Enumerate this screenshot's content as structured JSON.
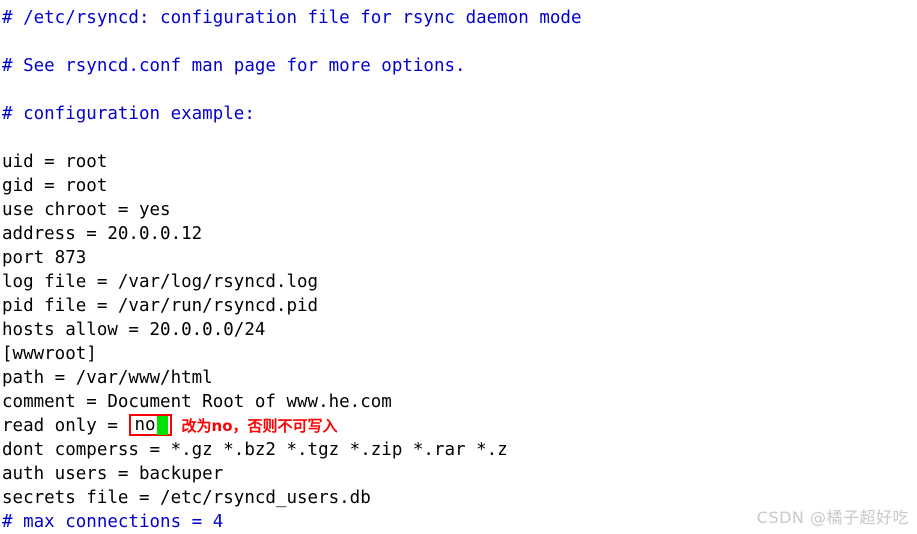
{
  "editor": {
    "lines": [
      {
        "text": "# /etc/rsyncd: configuration file for rsync daemon mode",
        "style": "comment"
      },
      {
        "text": "",
        "style": "normal"
      },
      {
        "text": "# See rsyncd.conf man page for more options.",
        "style": "comment"
      },
      {
        "text": "",
        "style": "normal"
      },
      {
        "text": "# configuration example:",
        "style": "comment"
      },
      {
        "text": "",
        "style": "normal"
      },
      {
        "text": "uid = root",
        "style": "normal"
      },
      {
        "text": "gid = root",
        "style": "normal"
      },
      {
        "text": "use chroot = yes",
        "style": "normal"
      },
      {
        "text": "address = 20.0.0.12",
        "style": "normal"
      },
      {
        "text": "port 873",
        "style": "normal"
      },
      {
        "text": "log file = /var/log/rsyncd.log",
        "style": "normal"
      },
      {
        "text": "pid file = /var/run/rsyncd.pid",
        "style": "normal"
      },
      {
        "text": "hosts allow = 20.0.0.0/24",
        "style": "normal"
      },
      {
        "text": "[wwwroot]",
        "style": "normal"
      },
      {
        "text": "path = /var/www/html",
        "style": "normal"
      },
      {
        "text": "comment = Document Root of www.he.com",
        "style": "normal"
      }
    ],
    "highlighted_line": {
      "prefix": "read only = ",
      "value": "no",
      "annotation": "改为no，否则不可写入",
      "box_color": "#ff0000",
      "cursor_color": "#00e000"
    },
    "lines_after": [
      {
        "text": "dont comperss = *.gz *.bz2 *.tgz *.zip *.rar *.z",
        "style": "normal"
      },
      {
        "text": "auth users = backuper",
        "style": "normal"
      },
      {
        "text": "secrets file = /etc/rsyncd_users.db",
        "style": "normal"
      },
      {
        "text": "# max connections = 4",
        "style": "comment"
      }
    ]
  },
  "watermark": {
    "text": "CSDN @橘子超好吃"
  }
}
